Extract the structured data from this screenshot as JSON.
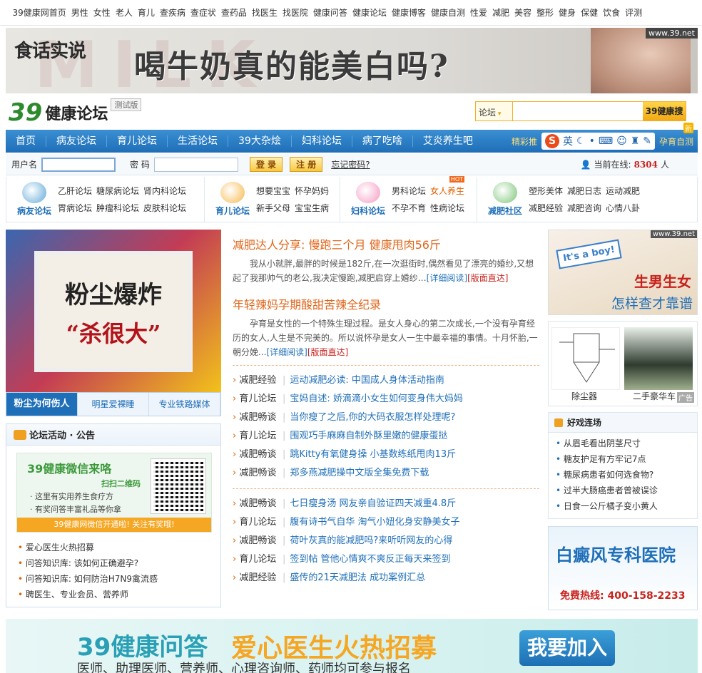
{
  "topnav": [
    "39健康网首页",
    "男性",
    "女性",
    "老人",
    "育儿",
    "查疾病",
    "查症状",
    "查药品",
    "找医生",
    "找医院",
    "健康问答",
    "健康论坛",
    "健康博客",
    "健康自测",
    "性爱",
    "减肥",
    "美容",
    "整形",
    "健身",
    "保健",
    "饮食",
    "评测"
  ],
  "banner": {
    "brand": "食话实说",
    "headline": "喝牛奶真的能美白吗?",
    "badge": "www.39.net"
  },
  "logo": {
    "num": "39",
    "title": "健康论坛",
    "beta": "测试版"
  },
  "search": {
    "scope": "论坛",
    "button": "39健康搜"
  },
  "mainnav": {
    "items": [
      "首页",
      "病友论坛",
      "育儿论坛",
      "生活论坛",
      "39大杂烩",
      "妇科论坛",
      "病了吃啥",
      "艾炎养生吧"
    ],
    "featured": "精彩推",
    "toolbar": [
      "S",
      "英"
    ],
    "right_link": "孕育自测",
    "new_badge": "新"
  },
  "login": {
    "user_label": "用户名",
    "pass_label": "密 码",
    "login_btn": "登 录",
    "register_btn": "注 册",
    "forgot": "忘记密码?",
    "online_label": "当前在线:",
    "online_count": "8304",
    "online_unit": "人"
  },
  "cats": [
    {
      "label": "病友论坛",
      "color": "#5fa8d8",
      "links": [
        "乙肝论坛",
        "糖尿病论坛",
        "肾内科论坛",
        "胃病论坛",
        "肿瘤科论坛",
        "皮肤科论坛"
      ]
    },
    {
      "label": "育儿论坛",
      "color": "#f7b84b",
      "links": [
        "想要宝宝",
        "怀孕妈妈",
        "",
        "新手父母",
        "宝宝生病",
        ""
      ]
    },
    {
      "label": "妇科论坛",
      "color": "#f49ac1",
      "links": [
        "男科论坛",
        "女人养生",
        "",
        "不孕不育",
        "性病论坛",
        ""
      ],
      "hot": "HOT"
    },
    {
      "label": "减肥社区",
      "color": "#7cc576",
      "links": [
        "塑形美体",
        "减肥日志",
        "运动减肥",
        "减肥经验",
        "减肥咨询",
        "心情八卦"
      ]
    }
  ],
  "leftad": {
    "line1": "粉尘爆炸",
    "line2": "“杀很大”"
  },
  "lefttabs": [
    "粉尘为何伤人",
    "明星爱裸睡",
    "专业铁路媒体"
  ],
  "forum": {
    "title": "论坛活动 · 公告",
    "wx": {
      "title": "39健康微信来咯",
      "scan": "扫扫二维码",
      "p1": "· 这里有实用养生食疗方",
      "p2": "· 有奖问答丰富礼品等你拿",
      "bar": "39健康网微信开通啦! 关注有奖哦!"
    },
    "items": [
      "爱心医生火热招募",
      "问答知识库: 该如何正确避孕?",
      "问答知识库: 如何防治H7N9禽流感",
      "聘医生、专业会员、营养师"
    ]
  },
  "center": {
    "story1": {
      "title": "减肥达人分享: 慢跑三个月 健康甩肉56斤",
      "body": "我从小就胖,最胖的时候是182斤,在一次逛街时,偶然看见了漂亮的婚纱,又想起了我那帅气的老公,我决定慢跑,减肥启穿上婚纱…",
      "more": "[详细阅读]",
      "more2": "[版面直达]"
    },
    "story2": {
      "title": "年轻辣妈孕期酸甜苦辣全纪录",
      "body": "孕育是女性的一个特殊生理过程。是女人身心的第二次成长,一个没有孕育经历的女人,人生是不完美的。所以说怀孕是女人一生中最幸福的事情。十月怀胎,一朝分娩...",
      "more": "[详细阅读]",
      "more2": "[版面直达]"
    },
    "list1": [
      {
        "cat": "减肥经验",
        "title": "运动减肥必读: 中国成人身体活动指南"
      },
      {
        "cat": "育儿论坛",
        "title": "宝妈自述: 娇滴滴小女生如何变身伟大妈妈"
      },
      {
        "cat": "减肥畅谈",
        "title": "当你瘦了之后,你的大码衣服怎样处理呢?"
      },
      {
        "cat": "育儿论坛",
        "title": "围观巧手麻麻自制外酥里嫩的健康蛋挞"
      },
      {
        "cat": "减肥畅谈",
        "title": "跳Kitty有氧健身操 小基数练纸甩肉13斤"
      },
      {
        "cat": "减肥畅谈",
        "title": "郑多燕减肥操中文版全集免费下载"
      }
    ],
    "list2": [
      {
        "cat": "减肥畅谈",
        "title": "七日瘦身汤 网友亲自验证四天减重4.8斤"
      },
      {
        "cat": "育儿论坛",
        "title": "腹有诗书气自华 淘气小妞化身安静美女子"
      },
      {
        "cat": "减肥畅谈",
        "title": "荷叶灰真的能减肥吗?来听听网友的心得"
      },
      {
        "cat": "育儿论坛",
        "title": "签到帖 管他心情爽不爽反正每天来签到"
      },
      {
        "cat": "减肥经验",
        "title": "盛传的21天减肥法 成功案例汇总"
      }
    ]
  },
  "rightad1": {
    "sign": "It's a boy!",
    "t1": "生男生女",
    "t2": "怎样查才靠谱",
    "badge": "www.39.net"
  },
  "rightimg": {
    "cap1": "除尘器",
    "cap2": "二手豪华车",
    "ad": "广告"
  },
  "games": {
    "title": "好戏连场",
    "items": [
      "从眉毛看出阴茎尺寸",
      "糖友护足有方牢记7点",
      "糖尿病患者如何选食物?",
      "过半大肠癌患者曾被误诊",
      "日食一公斤橘子变小黄人"
    ]
  },
  "rightad2": {
    "title": "白癜风专科医院",
    "phone": "免费热线: 400-158-2233"
  },
  "bottomad": {
    "a": "39健康问答",
    "b": "爱心医生火热招募",
    "c": "医师、助理医师、营养师、心理咨询师、药师均可参与报名",
    "btn": "我要加入"
  }
}
